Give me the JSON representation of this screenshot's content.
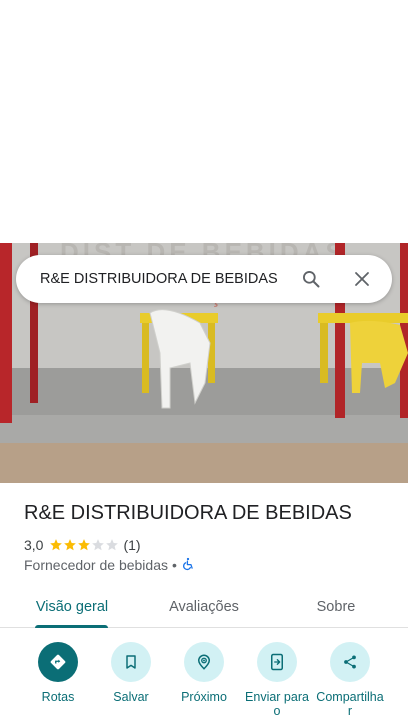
{
  "search": {
    "query": "R&E DISTRIBUIDORA DE BEBIDAS"
  },
  "place": {
    "title": "R&E DISTRIBUIDORA DE BEBIDAS",
    "rating": "3,0",
    "rating_value": 3,
    "rating_max": 5,
    "review_count": "(1)",
    "category": "Fornecedor de bebidas",
    "separator": "•",
    "accessibility_icon": "wheelchair-icon"
  },
  "tabs": [
    {
      "label": "Visão geral",
      "active": true
    },
    {
      "label": "Avaliações",
      "active": false
    },
    {
      "label": "Sobre",
      "active": false
    }
  ],
  "actions": [
    {
      "label": "Rotas",
      "icon": "directions-icon",
      "primary": true
    },
    {
      "label": "Salvar",
      "icon": "bookmark-icon",
      "primary": false
    },
    {
      "label": "Próximo",
      "icon": "nearby-icon",
      "primary": false
    },
    {
      "label": "Enviar para o",
      "icon": "send-to-device-icon",
      "primary": false
    },
    {
      "label": "Compartilhar",
      "icon": "share-icon",
      "primary": false
    }
  ],
  "colors": {
    "accent": "#0b6e76",
    "accent_light": "#d2f1f4",
    "star_filled": "#fbbc04",
    "star_empty": "#dadce0"
  }
}
